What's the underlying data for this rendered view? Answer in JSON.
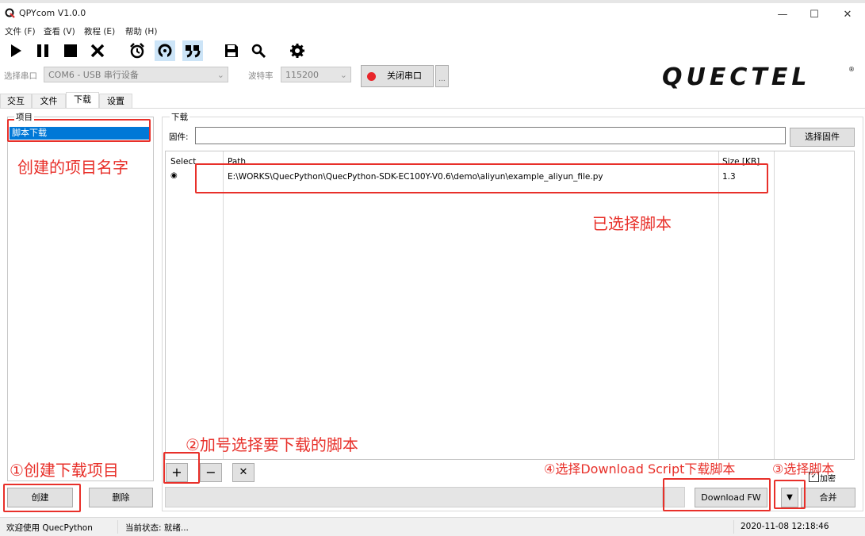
{
  "window": {
    "title": "QPYcom V1.0.0",
    "minimize": "—",
    "maximize": "☐",
    "close": "✕"
  },
  "menu": [
    "文件 (F)",
    "查看 (V)",
    "教程 (E)",
    "帮助 (H)"
  ],
  "toolbar": {
    "icons": [
      "play-icon",
      "pause-icon",
      "stop-icon",
      "close-icon",
      "alarm-clock-icon",
      "loop-icon",
      "quote-icon",
      "save-icon",
      "search-icon",
      "gear-icon"
    ]
  },
  "serial": {
    "port_label": "选择串口",
    "port_value": "COM6 - USB 串行设备",
    "baud_label": "波特率",
    "baud_value": "115200",
    "close_port_label": "关闭串口",
    "more_label": "...",
    "status_color": "#e8262b"
  },
  "brand": {
    "logo_text": "QUECTEL",
    "registered": "®"
  },
  "tabs": [
    "交互",
    "文件",
    "下载",
    "设置"
  ],
  "project": {
    "group_label": "项目",
    "items": [
      "脚本下载"
    ],
    "create_button": "创建",
    "delete_button": "删除"
  },
  "download": {
    "group_label": "下载",
    "firmware_label": "固件:",
    "firmware_value": "",
    "select_firmware_button": "选择固件",
    "columns": [
      "Select",
      "Path",
      "Size [KB]"
    ],
    "rows": [
      {
        "selected": "◉",
        "path": "E:\\WORKS\\QuecPython\\QuecPython-SDK-EC100Y-V0.6\\demo\\aliyun\\example_aliyun_file.py",
        "size": "1.3"
      }
    ],
    "add_button": "+",
    "remove_button": "−",
    "clear_button": "✕",
    "encrypt_label": "加密",
    "encrypt_checked": true,
    "download_fw_button": "Download FW",
    "dropdown_arrow": "▼",
    "merge_button": "合并"
  },
  "status": {
    "welcome": "欢迎使用 QuecPython",
    "state": "当前状态: 就绪...",
    "datetime": "2020-11-08 12:18:46"
  },
  "annotations": {
    "project_name": "创建的项目名字",
    "script_selected": "已选择脚本",
    "step1": "①创建下载项目",
    "step2": "②加号选择要下载的脚本",
    "step3": "③选择脚本",
    "step4": "④选择Download Script下载脚本"
  },
  "colors": {
    "annotation": "#e8302a",
    "selection": "#0078d7",
    "accent_active": "#cce4f7"
  }
}
